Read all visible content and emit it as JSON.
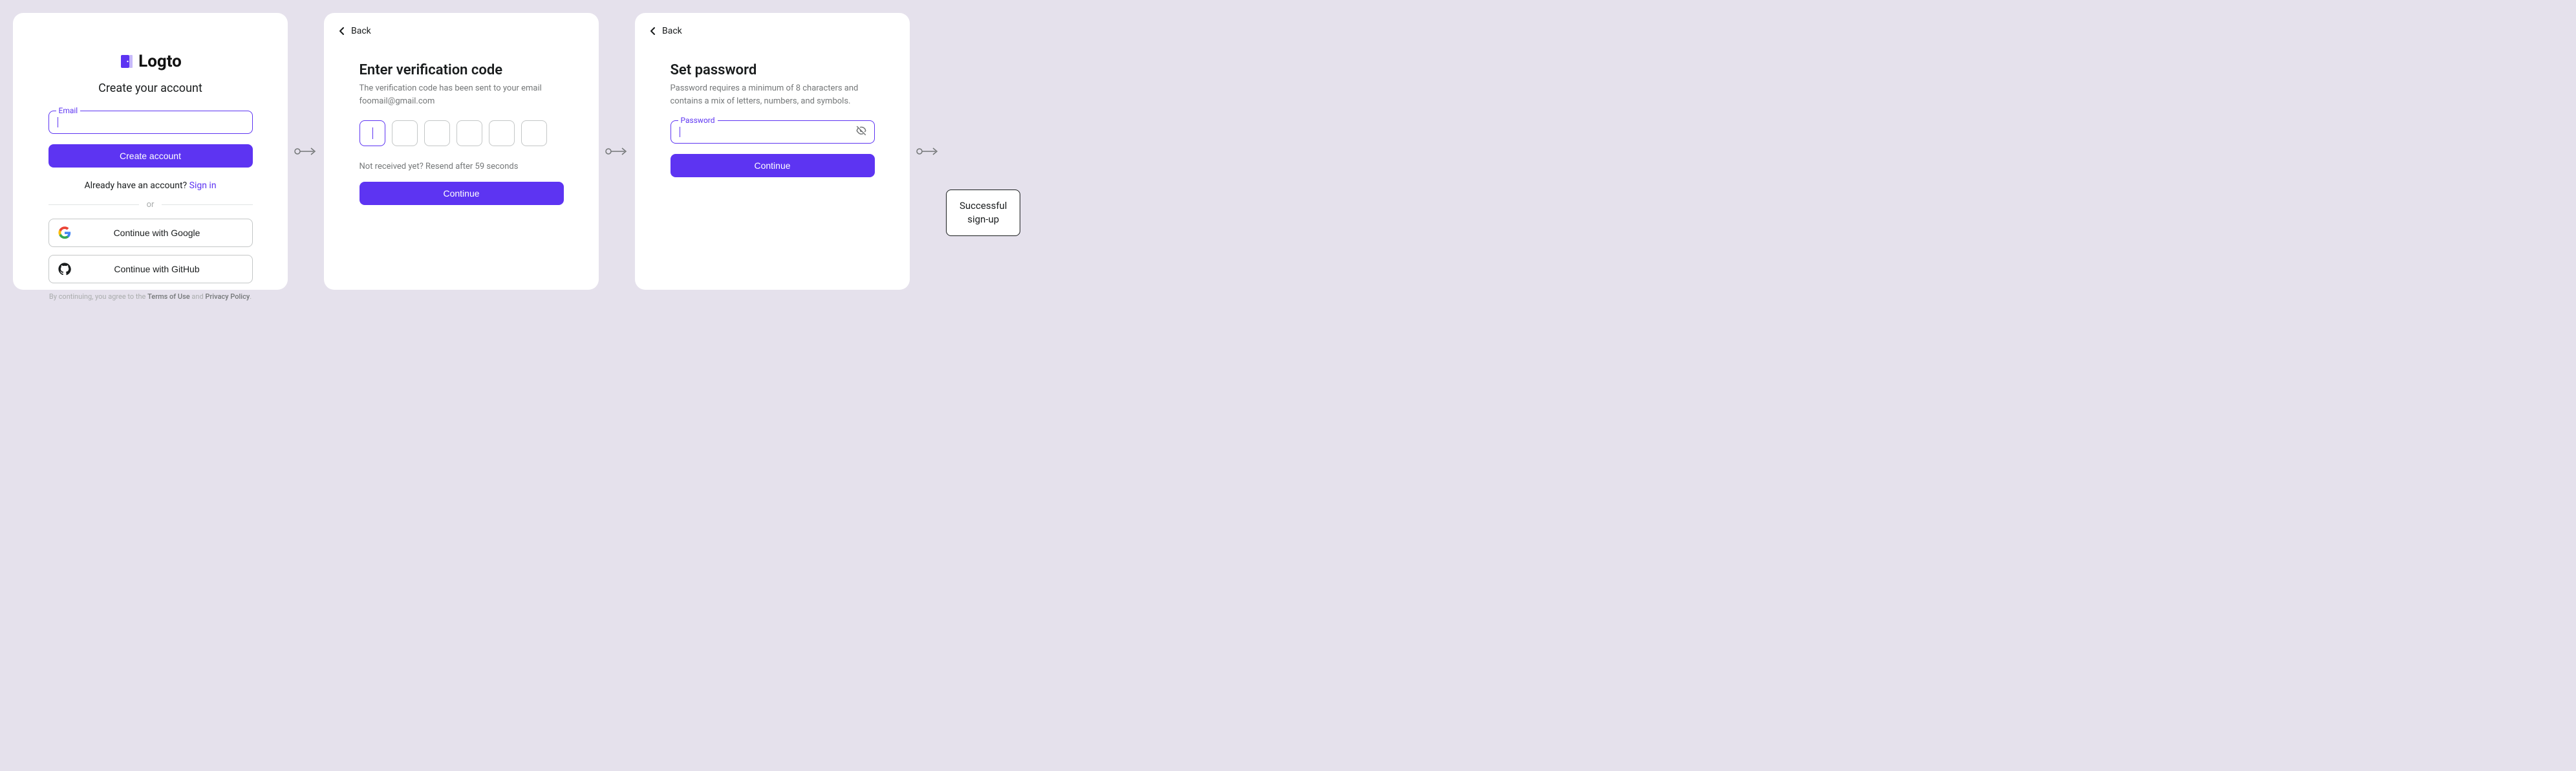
{
  "brand": "Logto",
  "signup": {
    "title": "Create your account",
    "email_label": "Email",
    "submit": "Create account",
    "signin_prefix": "Already have an account? ",
    "signin_link": "Sign in",
    "divider": "or",
    "social_google": "Continue with Google",
    "social_github": "Continue with GitHub",
    "terms_prefix": "By continuing, you agree to the ",
    "terms_link1": "Terms of Use",
    "terms_mid": " and ",
    "terms_link2": "Privacy Policy",
    "terms_suffix": "."
  },
  "verify": {
    "back": "Back",
    "title": "Enter verification code",
    "desc_line1": "The verification code has been sent to your email",
    "desc_email": "foomail@gmail.com",
    "resend": "Not received yet? Resend after 59 seconds",
    "continue": "Continue"
  },
  "password": {
    "back": "Back",
    "title": "Set password",
    "desc": "Password requires a minimum of 8 characters and contains a mix of letters, numbers, and symbols.",
    "field_label": "Password",
    "continue": "Continue"
  },
  "result": "Successful\nsign-up"
}
